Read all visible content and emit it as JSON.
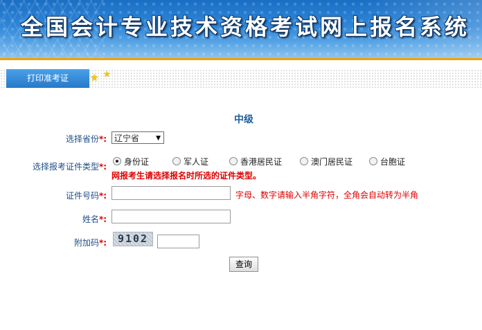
{
  "header": {
    "title": "全国会计专业技术资格考试网上报名系统"
  },
  "tabs": [
    {
      "label": "打印准考证"
    }
  ],
  "form": {
    "level": "中级",
    "province": {
      "label": "选择省份",
      "required_mark": "*:",
      "value": "辽宁省"
    },
    "id_type": {
      "label": "选择报考证件类型",
      "required_mark": "*:",
      "options": [
        {
          "label": "身份证",
          "selected": true
        },
        {
          "label": "军人证",
          "selected": false
        },
        {
          "label": "香港居民证",
          "selected": false
        },
        {
          "label": "澳门居民证",
          "selected": false
        },
        {
          "label": "台胞证",
          "selected": false
        }
      ],
      "warning": "网报考生请选择报名时所选的证件类型。"
    },
    "id_number": {
      "label": "证件号码",
      "required_mark": "*:",
      "value": "",
      "hint": "字母、数字请输入半角字符，全角会自动转为半角"
    },
    "name": {
      "label": "姓名",
      "required_mark": "*:",
      "value": ""
    },
    "captcha": {
      "label": "附加码",
      "required_mark": "*:",
      "image_text": "9102",
      "value": ""
    },
    "submit_label": "查询"
  },
  "colors": {
    "accent": "#2679c9",
    "orange_rule": "#f3a100",
    "label": "#1f4e87",
    "error": "#e00000"
  }
}
